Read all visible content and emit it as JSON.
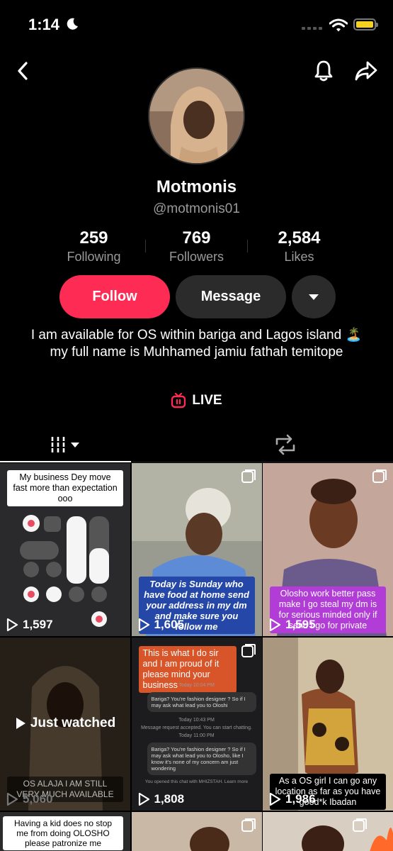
{
  "status": {
    "time": "1:14"
  },
  "profile": {
    "display_name": "Motmonis",
    "handle": "@motmonis01",
    "stats": [
      {
        "value": "259",
        "label": "Following"
      },
      {
        "value": "769",
        "label": "Followers"
      },
      {
        "value": "2,584",
        "label": "Likes"
      }
    ],
    "follow_label": "Follow",
    "message_label": "Message",
    "bio": "I am available for OS within bariga and Lagos island 🏝️ my full name is Muhhamed jamiu fathah temitope",
    "live_label": "LIVE"
  },
  "videos": [
    {
      "caption": "My business Dey move fast more than expectation ooo",
      "views": "1,597"
    },
    {
      "caption": "Today is Sunday who have food at home send your address in my dm and make sure you follow me",
      "views": "1,605"
    },
    {
      "caption": "Olosho work better pass make I go steal my dm is for serious minded only if send I go for private",
      "views": "1,595"
    },
    {
      "caption": "OS ALAJA I AM STILL VERY MUCH AVAILABLE",
      "views": "5,060",
      "overlay": "Just watched"
    },
    {
      "caption": "This is what I do sir and I am proud of it please mind your business",
      "views": "1,808",
      "chat": {
        "time1": "Today 10:04 PM",
        "msg1": "Bariga? You're fashion designer ? So if I may ask what lead you to Oloshi",
        "time2": "Today 10:43 PM",
        "accepted": "Message request accepted. You can start chatting.",
        "time3": "Today 11:00 PM",
        "msg2": "Bariga? You're fashion designer ? So if I may ask what lead you to Olosho, like I know it's none of my concern am just wondering",
        "footer": "You opened this chat with MHIZSTAH. Learn more"
      }
    },
    {
      "caption": "As a OS girl I can go any location as far as you have good*k Ibadan",
      "views": "1,986"
    },
    {
      "caption": "Having a kid does no stop me from doing OLOSHO please patronize me",
      "views": ""
    },
    {
      "caption": "",
      "views": ""
    },
    {
      "caption": "",
      "views": ""
    }
  ],
  "colors": {
    "follow": "#fe2c55",
    "secondary_button": "#2b2b2b",
    "battery": "#f6d21f",
    "live_icon": "#fe2c55"
  }
}
